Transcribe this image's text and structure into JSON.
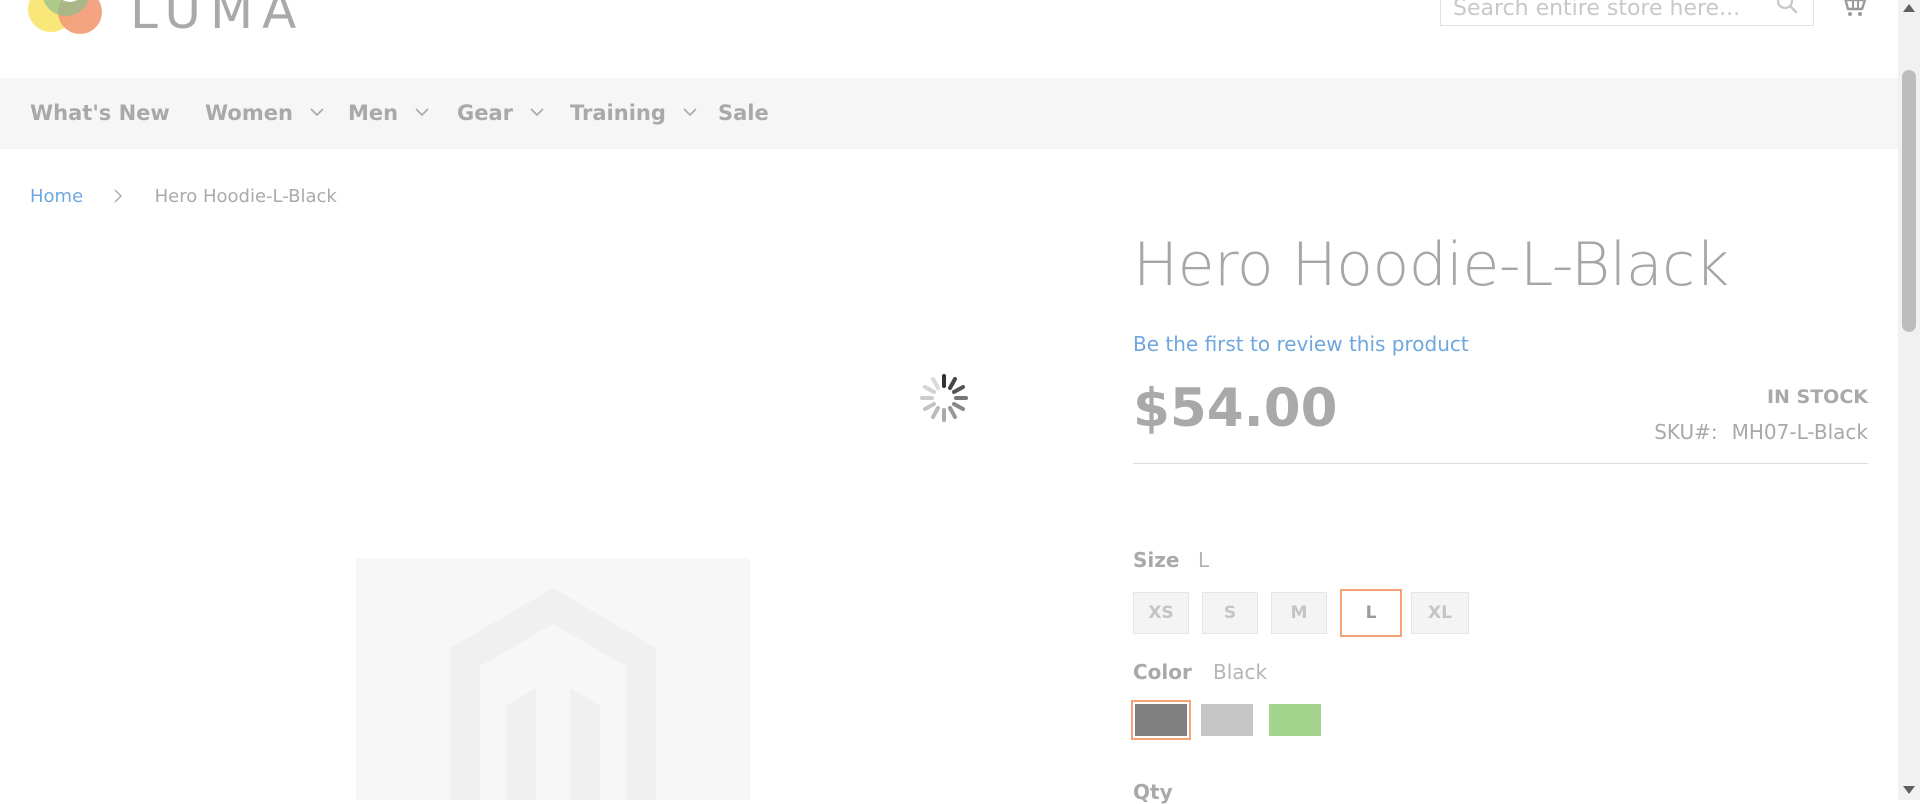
{
  "header": {
    "logo_text": "LUMA",
    "search_placeholder": "Search entire store here...",
    "search_icon": "search-icon",
    "cart_icon": "cart-icon"
  },
  "nav": {
    "items": [
      {
        "label": "What's New",
        "has_dropdown": false
      },
      {
        "label": "Women",
        "has_dropdown": true
      },
      {
        "label": "Men",
        "has_dropdown": true
      },
      {
        "label": "Gear",
        "has_dropdown": true
      },
      {
        "label": "Training",
        "has_dropdown": true
      },
      {
        "label": "Sale",
        "has_dropdown": false
      }
    ]
  },
  "breadcrumb": {
    "home": "Home",
    "current": "Hero Hoodie-L-Black"
  },
  "product": {
    "title": "Hero Hoodie-L-Black",
    "review_link": "Be the first to review this product",
    "price": "$54.00",
    "stock": "IN STOCK",
    "sku_label": "SKU#:",
    "sku_value": "MH07-L-Black",
    "size": {
      "label": "Size",
      "selected": "L",
      "options": [
        "XS",
        "S",
        "M",
        "L",
        "XL"
      ]
    },
    "color": {
      "label": "Color",
      "selected": "Black",
      "options": [
        {
          "name": "Black",
          "hex": "#808080"
        },
        {
          "name": "Gray",
          "hex": "#c6c6c6"
        },
        {
          "name": "Green",
          "hex": "#a5d48d"
        }
      ]
    },
    "qty_label": "Qty"
  },
  "colors": {
    "accent_link": "#6fa7dd",
    "selected_border": "#f5a478",
    "nav_bg": "#f6f6f6"
  }
}
